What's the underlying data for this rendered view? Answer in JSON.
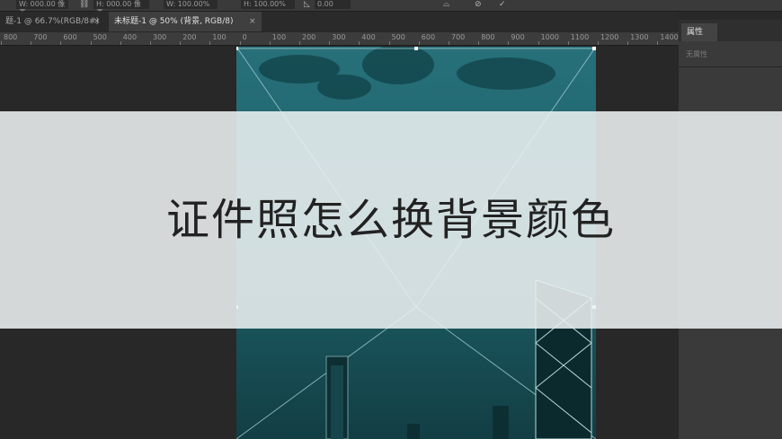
{
  "options_bar": {
    "fields": [
      "W: 000.00 像素",
      "H: 000.00 像素",
      "W: 100.00%",
      "H: 100.00%",
      "0.00"
    ],
    "icons": [
      "link-icon",
      "angle-icon",
      "warp-icon",
      "cancel-icon",
      "commit-icon"
    ]
  },
  "tabs": [
    {
      "label": "题-1 @ 66.7%(RGB/8#)",
      "close": "×",
      "active": false
    },
    {
      "label": "未标题-1 @ 50% (背景, RGB/8)",
      "close": "×",
      "active": true
    }
  ],
  "ruler": {
    "labels": [
      "800",
      "700",
      "600",
      "500",
      "400",
      "300",
      "200",
      "100",
      "0",
      "100",
      "200",
      "300",
      "400",
      "500",
      "600",
      "700",
      "800",
      "900",
      "1000",
      "1100",
      "1200",
      "1300",
      "1400"
    ]
  },
  "properties_panel": {
    "tab_label": "属性",
    "empty_text": "无属性"
  },
  "canvas": {
    "colors": {
      "background": "#1b5a60",
      "overlay": "#ecf0f1"
    }
  },
  "title": "证件照怎么换背景颜色"
}
